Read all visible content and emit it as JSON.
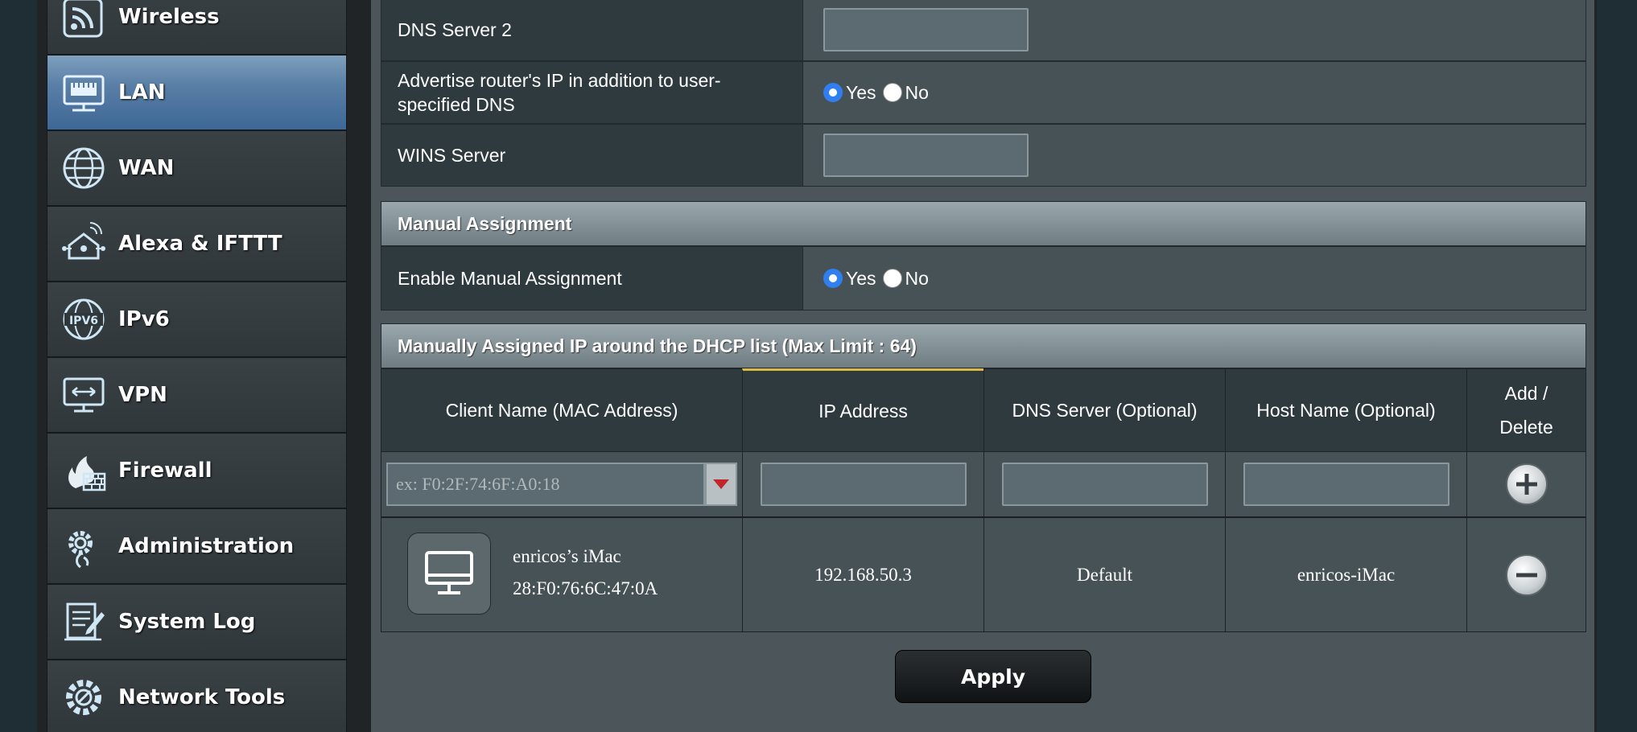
{
  "sidebar": {
    "items": [
      {
        "label": "Wireless",
        "icon": "wireless-icon"
      },
      {
        "label": "LAN",
        "icon": "lan-icon",
        "active": true
      },
      {
        "label": "WAN",
        "icon": "globe-icon"
      },
      {
        "label": "Alexa & IFTTT",
        "icon": "smart-home-icon"
      },
      {
        "label": "IPv6",
        "icon": "ipv6-icon"
      },
      {
        "label": "VPN",
        "icon": "vpn-icon"
      },
      {
        "label": "Firewall",
        "icon": "firewall-icon"
      },
      {
        "label": "Administration",
        "icon": "gear-icon"
      },
      {
        "label": "System Log",
        "icon": "log-icon"
      },
      {
        "label": "Network Tools",
        "icon": "gear-icon"
      }
    ]
  },
  "dns_server2": {
    "label": "DNS Server 2",
    "value": ""
  },
  "advertise": {
    "label": "Advertise router's IP in addition to user-specified DNS",
    "yes": "Yes",
    "no": "No",
    "selected": "Yes"
  },
  "wins": {
    "label": "WINS Server",
    "value": ""
  },
  "manual_assignment": {
    "title": "Manual Assignment",
    "enable_label": "Enable Manual Assignment",
    "yes": "Yes",
    "no": "No",
    "selected": "Yes"
  },
  "dhcp_list": {
    "title": "Manually Assigned IP around the DHCP list (Max Limit : 64)",
    "columns": [
      "Client Name (MAC Address)",
      "IP Address",
      "DNS Server (Optional)",
      "Host Name (Optional)",
      "Add / Delete"
    ],
    "mac_placeholder": "ex: F0:2F:74:6F:A0:18",
    "rows": [
      {
        "client_name": "enricos’s iMac",
        "mac": "28:F0:76:6C:47:0A",
        "ip": "192.168.50.3",
        "dns": "Default",
        "host": "enricos-iMac"
      }
    ]
  },
  "apply_label": "Apply",
  "colors": {
    "accent": "#2f7ff0",
    "active_nav": "#4f77a2",
    "panel": "#475256"
  }
}
